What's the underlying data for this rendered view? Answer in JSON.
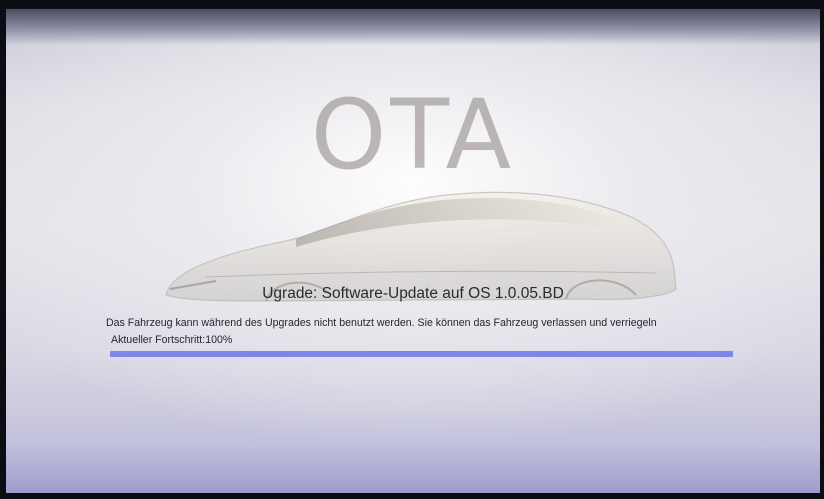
{
  "screen": {
    "logo_text": "OTA",
    "title": "Ugrade: Software-Update auf OS 1.0.05.BD",
    "description": "Das Fahrzeug kann während des Upgrades nicht benutzt werden. Sie können das Fahrzeug verlassen und verriegeln",
    "progress_label": "Aktueller Fortschritt:100%",
    "progress_fraction": 1.0
  },
  "colors": {
    "progress_fill": "#7f86ea",
    "progress_track": "#b9bbe6"
  },
  "icons": {
    "car_illustration": "car-silhouette-icon"
  }
}
